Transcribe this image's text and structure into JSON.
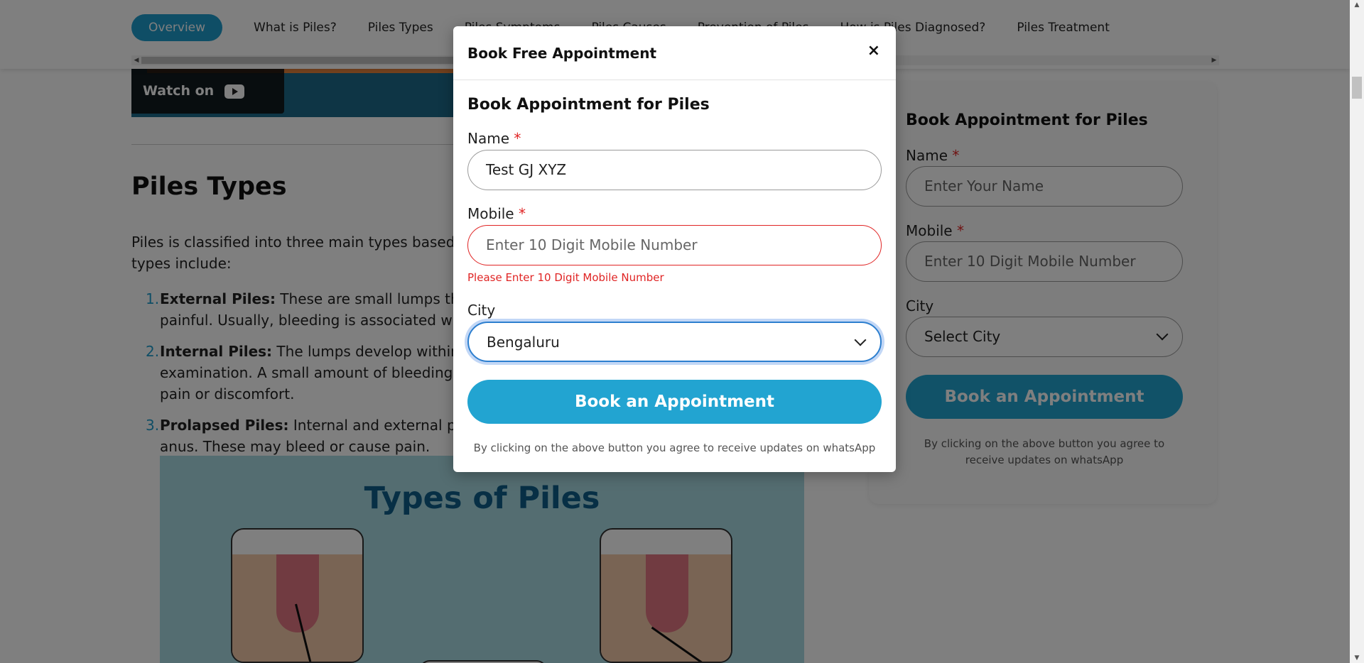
{
  "nav": {
    "tabs": [
      {
        "label": "Overview",
        "active": true
      },
      {
        "label": "What is Piles?"
      },
      {
        "label": "Piles Types"
      },
      {
        "label": "Piles Symptoms"
      },
      {
        "label": "Piles Causes"
      },
      {
        "label": "Prevention of Piles"
      },
      {
        "label": "How is Piles Diagnosed?"
      },
      {
        "label": "Piles Treatment"
      }
    ]
  },
  "video": {
    "watch_on": "Watch on",
    "brand": "YouTube"
  },
  "article": {
    "heading": "Piles Types",
    "intro": "Piles is classified into three main types based on the location where the swollen vein develops. The types include:",
    "items": [
      {
        "num": "1.",
        "term": "External Piles:",
        "text": " These are small lumps that develop outside the anus. They are very itchy and painful. Usually, bleeding is associated with external piles."
      },
      {
        "num": "2.",
        "term": "Internal Piles:",
        "text": " The lumps develop within the rectum and may not be visible during an external examination. A small amount of bleeding may be present with internal piles. They rarely cause pain or discomfort."
      },
      {
        "num": "3.",
        "term": "Prolapsed Piles:",
        "text": " Internal and external piles may prolapse or stretch and bulge outside the anus. These may bleed or cause pain."
      }
    ],
    "figure_title": "Types of Piles"
  },
  "sidebar_form": {
    "title": "Book Appointment for Piles",
    "name_label": "Name",
    "name_placeholder": "Enter Your Name",
    "mobile_label": "Mobile",
    "mobile_placeholder": "Enter 10 Digit Mobile Number",
    "city_label": "City",
    "city_value": "Select City",
    "submit": "Book an Appointment",
    "agree": "By clicking on the above button you agree to receive updates on whatsApp",
    "required_mark": "*"
  },
  "modal": {
    "title": "Book Free Appointment",
    "close": "×",
    "form_title": "Book Appointment for Piles",
    "name_label": "Name",
    "name_value": "Test GJ XYZ",
    "mobile_label": "Mobile",
    "mobile_placeholder": "Enter 10 Digit Mobile Number",
    "mobile_error": "Please Enter 10 Digit Mobile Number",
    "city_label": "City",
    "city_value": "Bengaluru",
    "submit": "Book an Appointment",
    "agree": "By clicking on the above button you agree to receive updates on whatsApp",
    "required_mark": "*"
  },
  "colors": {
    "accent": "#22a4d1",
    "error": "#e02424",
    "overlay": "rgba(0,0,0,0.5)"
  },
  "icons": {
    "close": "close-icon",
    "dropdown": "chevron-down-icon",
    "youtube": "youtube-logo-icon"
  }
}
